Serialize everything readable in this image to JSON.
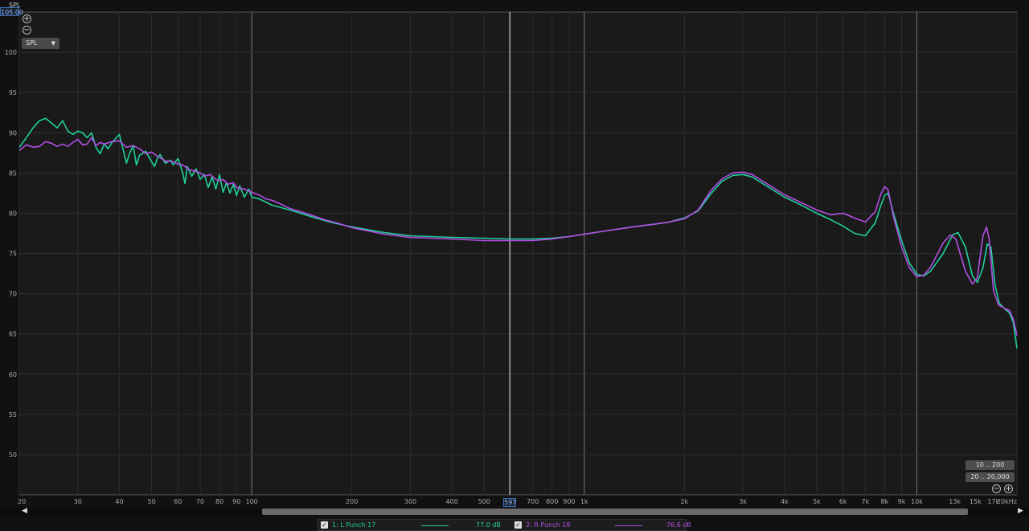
{
  "chart_data": {
    "type": "line",
    "ylabel": "SPL",
    "ylim": [
      45,
      105
    ],
    "y_max_display": "105.00",
    "xlim": [
      20,
      20000
    ],
    "x_scale": "log",
    "yticks": [
      "50",
      "55",
      "60",
      "65",
      "70",
      "75",
      "80",
      "85",
      "90",
      "95",
      "100"
    ],
    "ytick_values": [
      50,
      55,
      60,
      65,
      70,
      75,
      80,
      85,
      90,
      95,
      100
    ],
    "xticks": [
      {
        "v": 20,
        "t": "20"
      },
      {
        "v": 30,
        "t": "30"
      },
      {
        "v": 40,
        "t": "40"
      },
      {
        "v": 50,
        "t": "50"
      },
      {
        "v": 60,
        "t": "60"
      },
      {
        "v": 70,
        "t": "70"
      },
      {
        "v": 80,
        "t": "80"
      },
      {
        "v": 90,
        "t": "90"
      },
      {
        "v": 100,
        "t": "100"
      },
      {
        "v": 200,
        "t": "200"
      },
      {
        "v": 300,
        "t": "300"
      },
      {
        "v": 400,
        "t": "400"
      },
      {
        "v": 500,
        "t": "500"
      },
      {
        "v": 700,
        "t": "700"
      },
      {
        "v": 800,
        "t": "800"
      },
      {
        "v": 900,
        "t": "900"
      },
      {
        "v": 1000,
        "t": "1k"
      },
      {
        "v": 2000,
        "t": "2k"
      },
      {
        "v": 3000,
        "t": "3k"
      },
      {
        "v": 4000,
        "t": "4k"
      },
      {
        "v": 5000,
        "t": "5k"
      },
      {
        "v": 6000,
        "t": "6k"
      },
      {
        "v": 7000,
        "t": "7k"
      },
      {
        "v": 8000,
        "t": "8k"
      },
      {
        "v": 9000,
        "t": "9k"
      },
      {
        "v": 10000,
        "t": "10k"
      },
      {
        "v": 13000,
        "t": "13k"
      },
      {
        "v": 15000,
        "t": "15k"
      },
      {
        "v": 17000,
        "t": "17k"
      },
      {
        "v": 20000,
        "t": "20kHz"
      }
    ],
    "major_x": [
      100,
      1000,
      10000
    ],
    "cursor_x": 597,
    "cursor_label": "597",
    "series": [
      {
        "name": "1: L Punch 17",
        "color": "#1fcf9c",
        "value_label": "77.0 dB",
        "points": [
          [
            20,
            88.2
          ],
          [
            21,
            89.4
          ],
          [
            22,
            90.6
          ],
          [
            23,
            91.5
          ],
          [
            24,
            91.8
          ],
          [
            25,
            91.2
          ],
          [
            26,
            90.6
          ],
          [
            27,
            91.5
          ],
          [
            28,
            90.2
          ],
          [
            29,
            89.8
          ],
          [
            30,
            90.2
          ],
          [
            31,
            90.0
          ],
          [
            32,
            89.4
          ],
          [
            33,
            90.0
          ],
          [
            34,
            88.2
          ],
          [
            35,
            87.4
          ],
          [
            36,
            88.6
          ],
          [
            37,
            88.0
          ],
          [
            38,
            88.8
          ],
          [
            39,
            89.3
          ],
          [
            40,
            89.8
          ],
          [
            41,
            88.0
          ],
          [
            42,
            86.2
          ],
          [
            43,
            87.5
          ],
          [
            44,
            88.4
          ],
          [
            45,
            86.0
          ],
          [
            46,
            87.2
          ],
          [
            48,
            87.7
          ],
          [
            50,
            86.4
          ],
          [
            51,
            85.8
          ],
          [
            52,
            86.8
          ],
          [
            53,
            87.3
          ],
          [
            55,
            86.2
          ],
          [
            57,
            86.6
          ],
          [
            58,
            86.0
          ],
          [
            60,
            86.8
          ],
          [
            62,
            85.0
          ],
          [
            63,
            83.7
          ],
          [
            64,
            85.8
          ],
          [
            66,
            84.6
          ],
          [
            68,
            85.5
          ],
          [
            70,
            84.2
          ],
          [
            72,
            84.8
          ],
          [
            74,
            83.2
          ],
          [
            76,
            84.5
          ],
          [
            78,
            83.0
          ],
          [
            80,
            84.8
          ],
          [
            82,
            82.6
          ],
          [
            84,
            83.8
          ],
          [
            86,
            82.5
          ],
          [
            88,
            83.6
          ],
          [
            90,
            82.2
          ],
          [
            92,
            83.4
          ],
          [
            95,
            82.0
          ],
          [
            98,
            83.0
          ],
          [
            100,
            82.0
          ],
          [
            105,
            81.8
          ],
          [
            110,
            81.4
          ],
          [
            115,
            81.0
          ],
          [
            120,
            80.8
          ],
          [
            130,
            80.4
          ],
          [
            140,
            80.0
          ],
          [
            150,
            79.6
          ],
          [
            165,
            79.1
          ],
          [
            180,
            78.7
          ],
          [
            200,
            78.3
          ],
          [
            250,
            77.6
          ],
          [
            300,
            77.2
          ],
          [
            400,
            77.0
          ],
          [
            500,
            76.9
          ],
          [
            597,
            76.8
          ],
          [
            700,
            76.8
          ],
          [
            800,
            76.9
          ],
          [
            900,
            77.1
          ],
          [
            1000,
            77.4
          ],
          [
            1200,
            77.9
          ],
          [
            1400,
            78.3
          ],
          [
            1600,
            78.6
          ],
          [
            1800,
            78.9
          ],
          [
            2000,
            79.4
          ],
          [
            2200,
            80.3
          ],
          [
            2400,
            82.4
          ],
          [
            2600,
            84.0
          ],
          [
            2800,
            84.7
          ],
          [
            3000,
            84.8
          ],
          [
            3200,
            84.5
          ],
          [
            3500,
            83.5
          ],
          [
            4000,
            82.0
          ],
          [
            4500,
            81.0
          ],
          [
            5000,
            80.0
          ],
          [
            5500,
            79.2
          ],
          [
            6000,
            78.4
          ],
          [
            6500,
            77.5
          ],
          [
            7000,
            77.2
          ],
          [
            7500,
            78.8
          ],
          [
            7800,
            81.0
          ],
          [
            8000,
            82.2
          ],
          [
            8200,
            82.5
          ],
          [
            8500,
            80.0
          ],
          [
            9000,
            76.6
          ],
          [
            9500,
            73.8
          ],
          [
            10000,
            72.4
          ],
          [
            10500,
            72.2
          ],
          [
            11000,
            72.8
          ],
          [
            12000,
            75.0
          ],
          [
            12800,
            77.3
          ],
          [
            13300,
            77.6
          ],
          [
            14000,
            75.8
          ],
          [
            14700,
            72.2
          ],
          [
            15200,
            71.4
          ],
          [
            15800,
            73.2
          ],
          [
            16300,
            76.2
          ],
          [
            16700,
            75.8
          ],
          [
            17200,
            71.0
          ],
          [
            17700,
            68.8
          ],
          [
            18300,
            68.2
          ],
          [
            19000,
            67.6
          ],
          [
            19500,
            66.4
          ],
          [
            20000,
            63.2
          ]
        ]
      },
      {
        "name": "2: R Punch 18",
        "color": "#b34fe6",
        "value_label": "76.6 dB",
        "points": [
          [
            20,
            87.8
          ],
          [
            21,
            88.5
          ],
          [
            22,
            88.2
          ],
          [
            23,
            88.3
          ],
          [
            24,
            88.9
          ],
          [
            25,
            88.7
          ],
          [
            26,
            88.3
          ],
          [
            27,
            88.6
          ],
          [
            28,
            88.3
          ],
          [
            29,
            88.8
          ],
          [
            30,
            89.2
          ],
          [
            31,
            88.5
          ],
          [
            32,
            88.6
          ],
          [
            33,
            89.4
          ],
          [
            34,
            88.4
          ],
          [
            35,
            88.8
          ],
          [
            36,
            88.6
          ],
          [
            38,
            88.9
          ],
          [
            40,
            89.0
          ],
          [
            42,
            88.2
          ],
          [
            44,
            88.4
          ],
          [
            46,
            88.0
          ],
          [
            48,
            87.4
          ],
          [
            50,
            87.6
          ],
          [
            52,
            87.1
          ],
          [
            55,
            86.5
          ],
          [
            58,
            86.4
          ],
          [
            60,
            86.1
          ],
          [
            62,
            86.0
          ],
          [
            65,
            85.4
          ],
          [
            68,
            85.2
          ],
          [
            70,
            85.0
          ],
          [
            72,
            84.6
          ],
          [
            75,
            84.8
          ],
          [
            78,
            84.2
          ],
          [
            80,
            84.0
          ],
          [
            82,
            84.2
          ],
          [
            85,
            83.6
          ],
          [
            88,
            83.8
          ],
          [
            90,
            83.2
          ],
          [
            95,
            83.0
          ],
          [
            100,
            82.6
          ],
          [
            105,
            82.3
          ],
          [
            110,
            81.8
          ],
          [
            115,
            81.6
          ],
          [
            120,
            81.3
          ],
          [
            130,
            80.6
          ],
          [
            140,
            80.2
          ],
          [
            150,
            79.8
          ],
          [
            165,
            79.2
          ],
          [
            180,
            78.8
          ],
          [
            200,
            78.2
          ],
          [
            250,
            77.4
          ],
          [
            300,
            77.0
          ],
          [
            400,
            76.8
          ],
          [
            500,
            76.6
          ],
          [
            597,
            76.6
          ],
          [
            700,
            76.6
          ],
          [
            800,
            76.8
          ],
          [
            900,
            77.1
          ],
          [
            1000,
            77.4
          ],
          [
            1200,
            77.9
          ],
          [
            1400,
            78.3
          ],
          [
            1600,
            78.6
          ],
          [
            1800,
            78.9
          ],
          [
            2000,
            79.3
          ],
          [
            2200,
            80.4
          ],
          [
            2400,
            82.8
          ],
          [
            2600,
            84.3
          ],
          [
            2800,
            85.0
          ],
          [
            3000,
            85.1
          ],
          [
            3200,
            84.8
          ],
          [
            3500,
            83.8
          ],
          [
            4000,
            82.3
          ],
          [
            4500,
            81.3
          ],
          [
            5000,
            80.4
          ],
          [
            5500,
            79.8
          ],
          [
            6000,
            80.0
          ],
          [
            6500,
            79.4
          ],
          [
            7000,
            78.9
          ],
          [
            7500,
            80.2
          ],
          [
            7800,
            82.4
          ],
          [
            8000,
            83.3
          ],
          [
            8200,
            82.9
          ],
          [
            8500,
            79.6
          ],
          [
            9000,
            75.8
          ],
          [
            9500,
            73.2
          ],
          [
            10000,
            72.1
          ],
          [
            10500,
            72.3
          ],
          [
            11000,
            73.3
          ],
          [
            12000,
            76.3
          ],
          [
            12600,
            77.3
          ],
          [
            13100,
            76.8
          ],
          [
            14000,
            72.8
          ],
          [
            14700,
            71.2
          ],
          [
            15200,
            72.0
          ],
          [
            15800,
            77.2
          ],
          [
            16200,
            78.3
          ],
          [
            16500,
            76.8
          ],
          [
            17000,
            70.4
          ],
          [
            17600,
            68.6
          ],
          [
            18300,
            68.2
          ],
          [
            19000,
            67.9
          ],
          [
            19500,
            66.8
          ],
          [
            20000,
            64.8
          ]
        ]
      }
    ]
  },
  "ui": {
    "spl_dropdown": "SPL",
    "range_low": "10 .. 200",
    "range_full": "20 .. 20,000"
  }
}
